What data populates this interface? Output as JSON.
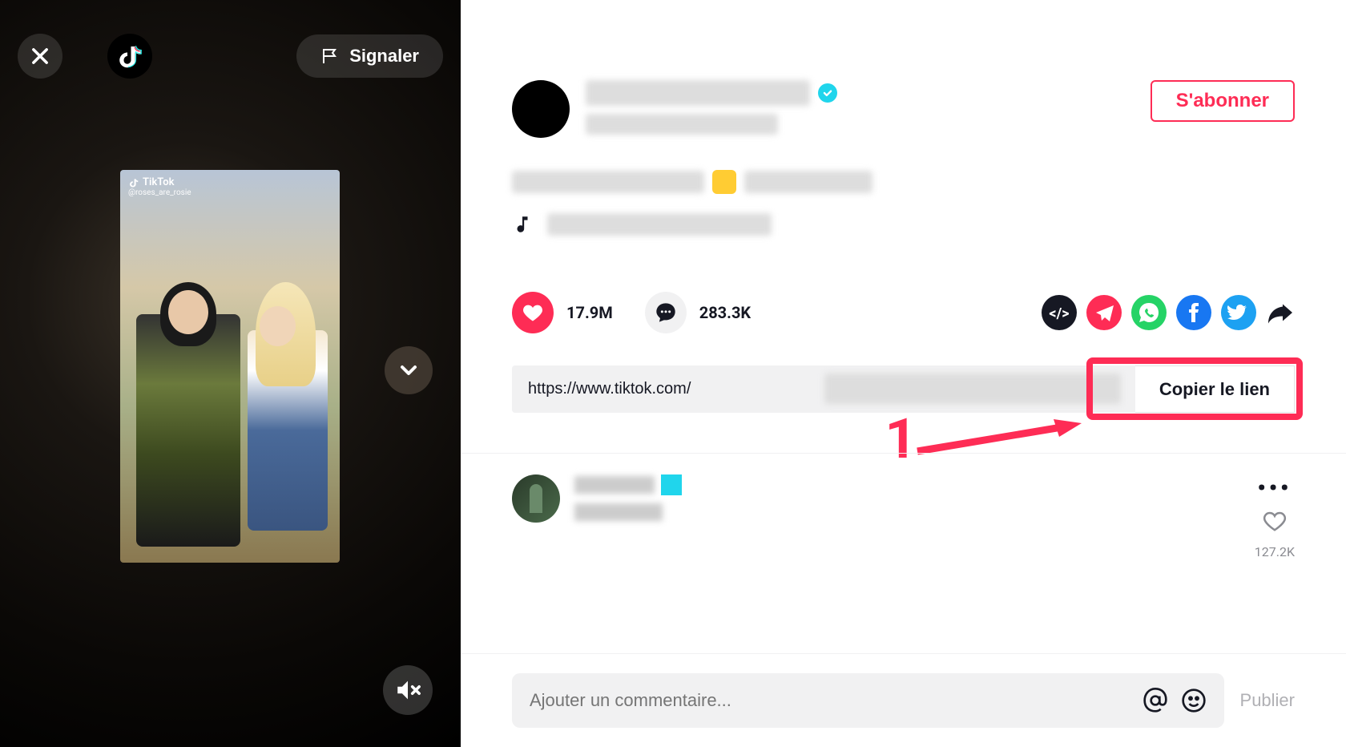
{
  "video": {
    "watermark_brand": "TikTok",
    "watermark_handle": "@roses_are_rosie",
    "report_label": "Signaler"
  },
  "details": {
    "follow_label": "S'abonner",
    "likes": "17.9M",
    "comments": "283.3K",
    "link_prefix": "https://www.tiktok.com/",
    "copy_label": "Copier le lien"
  },
  "share": {
    "icons": [
      "embed",
      "telegram",
      "whatsapp",
      "facebook",
      "twitter",
      "more"
    ]
  },
  "comment_top": {
    "like_count": "127.2K"
  },
  "comment_box": {
    "placeholder": "Ajouter un commentaire...",
    "publish_label": "Publier"
  },
  "annotation": {
    "step": "1"
  }
}
